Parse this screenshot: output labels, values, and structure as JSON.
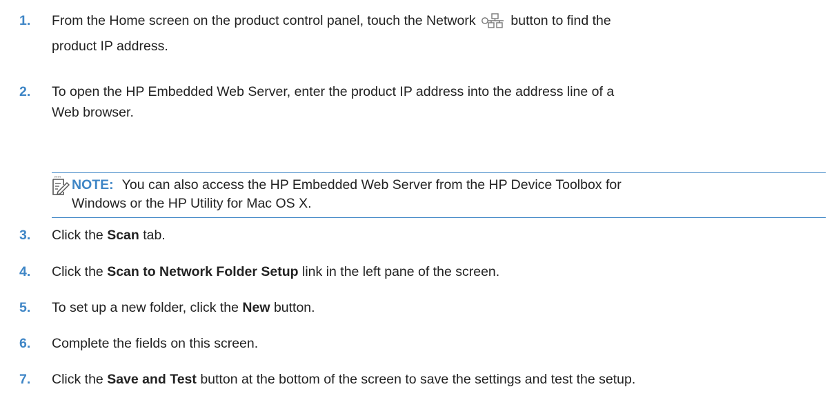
{
  "steps": [
    {
      "number": "1.",
      "text_before_icon": "From the Home screen on the product control panel, touch the Network",
      "icon": "network-icon",
      "text_after_icon": "button to find the",
      "text_line2": "product IP address."
    },
    {
      "number": "2.",
      "text": "To open the HP Embedded Web Server, enter the product IP address into the address line of a",
      "text_line2": "Web browser."
    },
    {
      "number": "3.",
      "pre": "Click the",
      "bold": "Scan",
      "post": "tab."
    },
    {
      "number": "4.",
      "pre": "Click the",
      "bold": "Scan to Network Folder Setup",
      "post": "link in the left pane of the screen."
    },
    {
      "number": "5.",
      "pre": "To set up a new folder, click the",
      "bold": "New",
      "post": "button."
    },
    {
      "number": "6.",
      "text": "Complete the fields on this screen."
    },
    {
      "number": "7.",
      "pre": "Click the",
      "bold": "Save and Test",
      "post": "button at the bottom of the screen to save the settings and test the setup."
    }
  ],
  "note": {
    "icon": "note-pencil-icon",
    "label": "NOTE:",
    "line1": "You can also access the HP Embedded Web Server from the HP Device Toolbox for",
    "line2": "Windows or the HP Utility for Mac OS X."
  },
  "colors": {
    "accent": "#3f86c6",
    "text": "#222222"
  }
}
